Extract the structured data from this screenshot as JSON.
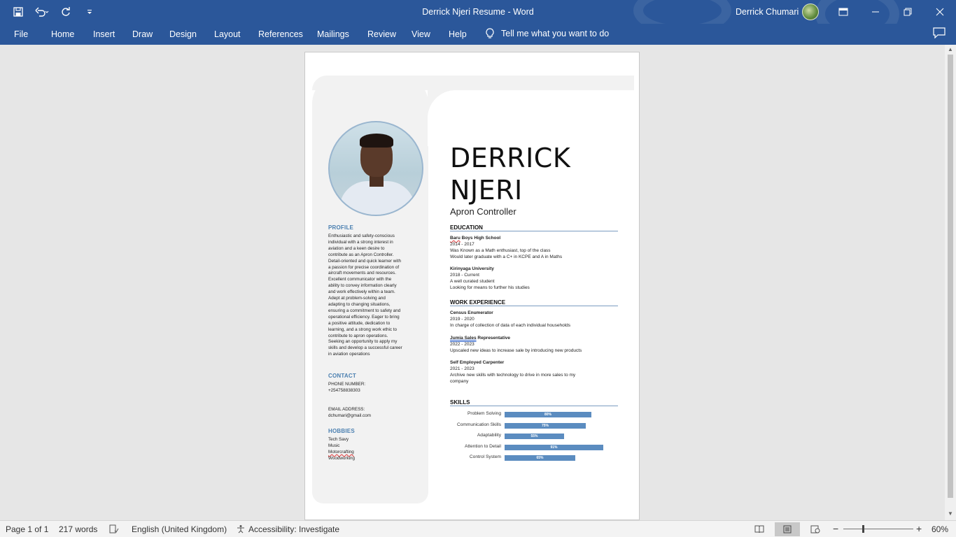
{
  "window": {
    "title": "Derrick Njeri Resume  -  Word",
    "user_name": "Derrick Chumari"
  },
  "ribbon": {
    "tabs": [
      "File",
      "Home",
      "Insert",
      "Draw",
      "Design",
      "Layout",
      "References",
      "Mailings",
      "Review",
      "View",
      "Help"
    ],
    "tell_me": "Tell me what you want to do"
  },
  "resume": {
    "first_name": "DERRICK",
    "last_name": "NJERI",
    "role": "Apron Controller",
    "profile_heading": "PROFILE",
    "profile_lines": [
      "Enthusiastic and safety-conscious",
      "individual with a strong interest in",
      "aviation and a keen desire to",
      "contribute as an Apron Controller.",
      "Detail-oriented and quick learner with",
      "a passion for precise coordination of",
      "aircraft movements and resources.",
      "Excellent communicator with the",
      "ability to convey information clearly",
      "and work effectively within a team.",
      "Adept at problem-solving and",
      "adapting to changing situations,",
      "ensuring a commitment to safety and",
      "operational efficiency. Eager to bring",
      "a positive attitude, dedication to",
      "learning, and a strong work ethic to",
      "contribute to apron operations.",
      "Seeking an opportunity to apply my",
      "skills and develop a successful career",
      "in aviation operations"
    ],
    "contact_heading": "CONTACT",
    "phone_label": "PHONE NUMBER:",
    "phone": "+254758838303",
    "email_label": "EMAIL ADDRESS:",
    "email": "dchumari@gmail.com",
    "hobbies_heading": "HOBBIES",
    "hobbies": [
      "Tech Savy",
      "Music",
      "Motorcrafting",
      "Woodworking"
    ],
    "education_heading": "EDUCATION",
    "education": [
      {
        "school_a": "Baru",
        "school_b": " Boys High School",
        "years": "2014 - 2017",
        "lines": [
          "Was Known as a Math enthusiast, top of the class",
          "Would later graduate with a C+ in KCPE and A in Maths"
        ]
      },
      {
        "school_a": "",
        "school_b": "Kirinyaga University",
        "years": "2018 - Current",
        "lines": [
          "A well curated student",
          "Looking for means to further his studies"
        ]
      }
    ],
    "work_heading": "WORK EXPERIENCE",
    "work": [
      {
        "title_a": "",
        "title_b": "Census Enumerator",
        "years": "2019 - 2020",
        "lines": [
          "In charge of collection of data of each individual households"
        ]
      },
      {
        "title_a": "Jumia  Sales",
        "title_b": " Representative",
        "years": "2022 - 2023",
        "lines": [
          "Upscaled new ideas to increase sale by introducing new products"
        ]
      },
      {
        "title_a": "",
        "title_b": "Self Employed Carpenter",
        "years": "2021 - 2023",
        "lines": [
          "Archive new skills with technology to drive in more sales to my",
          "company"
        ]
      }
    ],
    "skills_heading": "SKILLS",
    "skills": [
      {
        "label": "Problem Solving",
        "value": 80,
        "text": "80%"
      },
      {
        "label": "Communication Skills",
        "value": 75,
        "text": "75%"
      },
      {
        "label": "Adaptability",
        "value": 55,
        "text": "55%"
      },
      {
        "label": "Attention to Detail",
        "value": 91,
        "text": "91%"
      },
      {
        "label": "Control System",
        "value": 65,
        "text": "65%"
      }
    ]
  },
  "status": {
    "page": "Page 1 of 1",
    "words": "217 words",
    "language": "English (United Kingdom)",
    "accessibility": "Accessibility: Investigate",
    "zoom": "60%",
    "zoom_minus": "−",
    "zoom_plus": "+"
  },
  "colors": {
    "accent": "#2b579a",
    "section_heading": "#4a7fb0",
    "skill_bar": "#5b8cc0"
  }
}
